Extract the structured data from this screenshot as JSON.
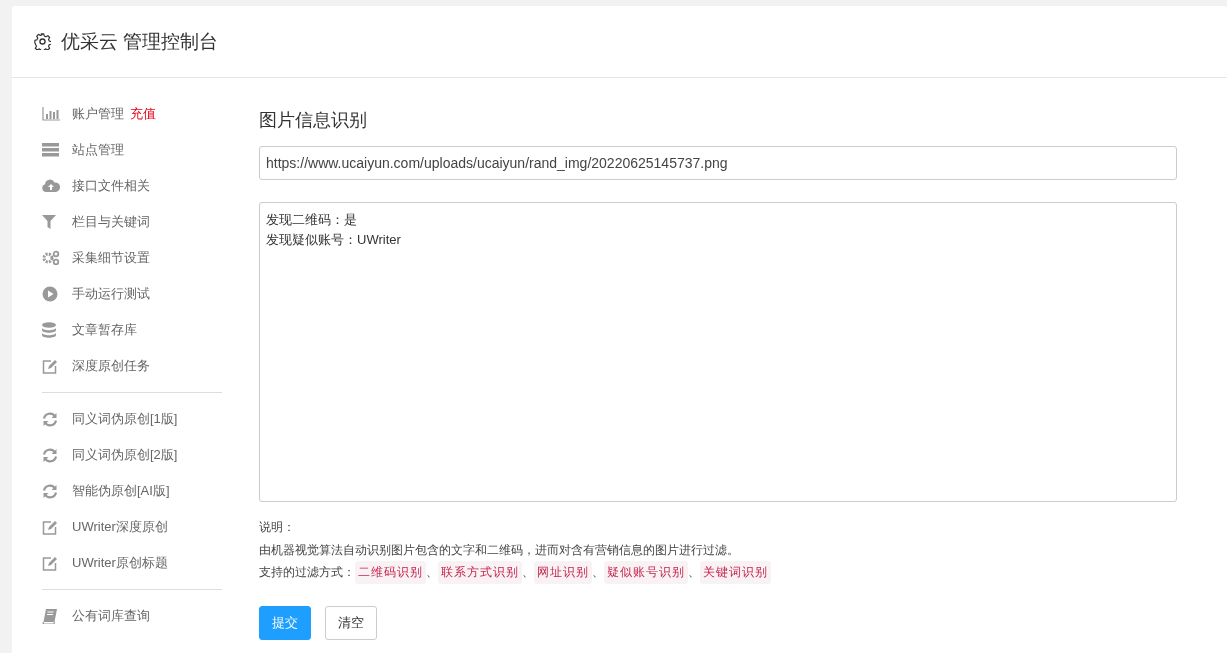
{
  "header": {
    "title": "优采云 管理控制台"
  },
  "sidebar": {
    "groups": [
      {
        "items": [
          {
            "label": "账户管理",
            "badge": "充值"
          },
          {
            "label": "站点管理"
          },
          {
            "label": "接口文件相关"
          },
          {
            "label": "栏目与关键词"
          },
          {
            "label": "采集细节设置"
          },
          {
            "label": "手动运行测试"
          },
          {
            "label": "文章暂存库"
          },
          {
            "label": "深度原创任务"
          }
        ]
      },
      {
        "items": [
          {
            "label": "同义词伪原创[1版]"
          },
          {
            "label": "同义词伪原创[2版]"
          },
          {
            "label": "智能伪原创[AI版]"
          },
          {
            "label": "UWriter深度原创"
          },
          {
            "label": "UWriter原创标题"
          }
        ]
      },
      {
        "items": [
          {
            "label": "公有词库查询"
          }
        ]
      }
    ]
  },
  "main": {
    "title": "图片信息识别",
    "url_field": {
      "value": "https://www.ucaiyun.com/uploads/ucaiyun/rand_img/20220625145737.png"
    },
    "result_field": {
      "lines": [
        "发现二维码：是",
        "发现疑似账号：UWriter"
      ]
    },
    "notes": {
      "heading": "说明：",
      "description": "由机器视觉算法自动识别图片包含的文字和二维码，进而对含有营销信息的图片进行过滤。",
      "filters_label": "支持的过滤方式：",
      "separator": "、",
      "filters": [
        "二维码识别",
        "联系方式识别",
        "网址识别",
        "疑似账号识别",
        "关键词识别"
      ]
    },
    "buttons": [
      {
        "label": "提交",
        "kind": "primary"
      },
      {
        "label": "清空",
        "kind": "default"
      }
    ]
  }
}
